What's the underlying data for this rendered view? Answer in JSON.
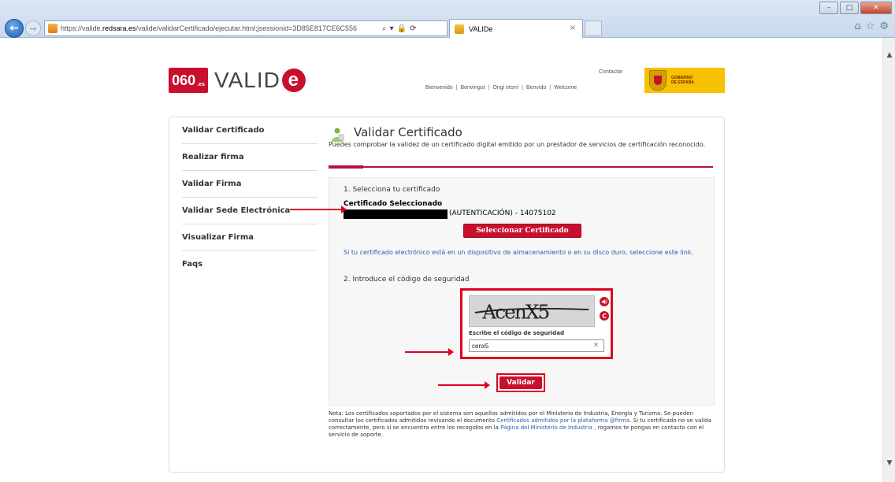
{
  "browser": {
    "url_prefix": "https://valide.",
    "url_domain": "redsara.es",
    "url_path": "/valide/validarCertificado/ejecutar.html;jsessionid=3D85E817CE6C556",
    "tab_title": "VALIDe",
    "back_glyph": "←",
    "forward_glyph": "→",
    "search_glyph": "⌕",
    "dropdown_glyph": "▾",
    "lock_glyph": "🔒",
    "refresh_glyph": "⟳",
    "close_glyph": "×",
    "win_min": "–",
    "win_max": "□",
    "win_close": "✕",
    "home_glyph": "⌂",
    "star_glyph": "☆",
    "gear_glyph": "⚙",
    "scroll_up": "▲",
    "scroll_down": "▼"
  },
  "header": {
    "logo_060": "060",
    "logo_060_suffix": ".es",
    "logo_valide": "VALID",
    "logo_e": "e",
    "contact": "Contactar",
    "languages": [
      "Bienvenido",
      "Benvingut",
      "Ongi etorri",
      "Benvido",
      "Welcome"
    ],
    "separator": "|",
    "gov_line1": "GOBIERNO",
    "gov_line2": "DE ESPAÑA"
  },
  "sidebar": {
    "items": [
      {
        "label": "Validar Certificado"
      },
      {
        "label": "Realizar firma"
      },
      {
        "label": "Validar Firma"
      },
      {
        "label": "Validar Sede Electrónica"
      },
      {
        "label": "Visualizar Firma"
      },
      {
        "label": "Faqs"
      }
    ]
  },
  "main": {
    "title": "Validar Certificado",
    "intro": "Puedes comprobar la validez de un certificado digital emitido por un prestador de servicios de certificación reconocido.",
    "step1": "1. Selecciona tu certificado",
    "cert_selected_label": "Certificado Seleccionado",
    "cert_name": "(AUTENTICACIÓN) - 14075102",
    "select_button": "Seleccionar Certificado",
    "link_text": "Si tu certificado electrónico está en un dispositivo de almacenamiento o en su disco duro, seleccione este link.",
    "step2": "2. Introduce el código de seguridad",
    "captcha_text": "AcenX5",
    "captcha_audio_glyph": "◀)",
    "captcha_refresh_glyph": "C",
    "captcha_label": "Escribe el código de seguridad",
    "captcha_value": "cenx5",
    "captcha_clear": "×",
    "validate_button": "Validar",
    "note_prefix": "Nota: Los certificados soportados por el sistema son aquellos admitidos por el Ministerio de Industria, Energía y Turismo. Se pueden consultar los certificados admitidos revisando el documento ",
    "note_link1": "Certificados admitidos por la plataforma @firma",
    "note_mid": ". Si tu certificado no se valida correctamente, pero sí se encuentra entre los recogidos en la ",
    "note_link2": "Página del Ministerio de Industria",
    "note_suffix": " , rogamos te pongas en contacto con el servicio de soporte."
  },
  "colors": {
    "accent_red": "#c8102e",
    "annotation_red": "#e00020",
    "link_blue": "#2a5db0"
  }
}
